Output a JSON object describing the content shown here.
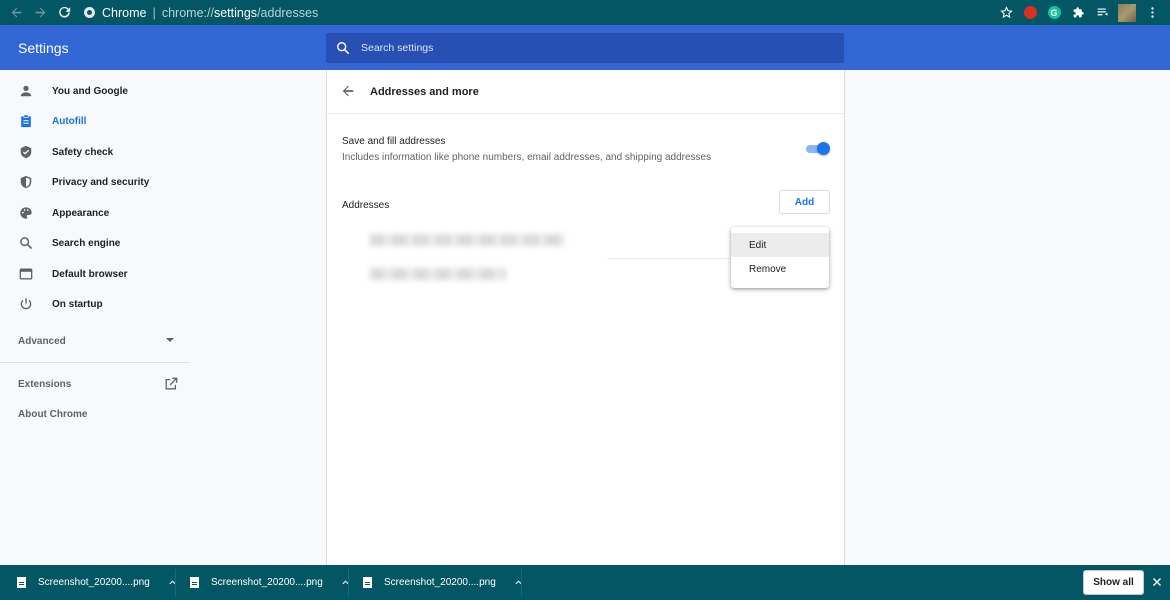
{
  "browser": {
    "site_label": "Chrome",
    "url_host": "chrome://",
    "url_path_strong": "settings",
    "url_path_rest": "/addresses",
    "extension_red_letter": "",
    "extension_green_letter": "G"
  },
  "header": {
    "title": "Settings",
    "search_placeholder": "Search settings"
  },
  "sidebar": {
    "items": [
      {
        "label": "You and Google",
        "icon": "person-icon"
      },
      {
        "label": "Autofill",
        "icon": "clipboard-icon",
        "active": true
      },
      {
        "label": "Safety check",
        "icon": "shield-check-icon"
      },
      {
        "label": "Privacy and security",
        "icon": "shield-icon"
      },
      {
        "label": "Appearance",
        "icon": "palette-icon"
      },
      {
        "label": "Search engine",
        "icon": "search-icon"
      },
      {
        "label": "Default browser",
        "icon": "browser-icon"
      },
      {
        "label": "On startup",
        "icon": "power-icon"
      }
    ],
    "advanced_label": "Advanced",
    "extensions_label": "Extensions",
    "about_label": "About Chrome"
  },
  "main": {
    "page_title": "Addresses and more",
    "save_fill_label": "Save and fill addresses",
    "save_fill_sub": "Includes information like phone numbers, email addresses, and shipping addresses",
    "save_fill_enabled": true,
    "addresses_label": "Addresses",
    "add_button": "Add"
  },
  "context_menu": {
    "items": [
      "Edit",
      "Remove"
    ]
  },
  "downloads": {
    "items": [
      "Screenshot_20200....png",
      "Screenshot_20200....png",
      "Screenshot_20200....png"
    ],
    "show_all": "Show all"
  },
  "colors": {
    "browser_frame": "#035664",
    "settings_header": "#3367d6",
    "accent": "#1a73e8"
  }
}
